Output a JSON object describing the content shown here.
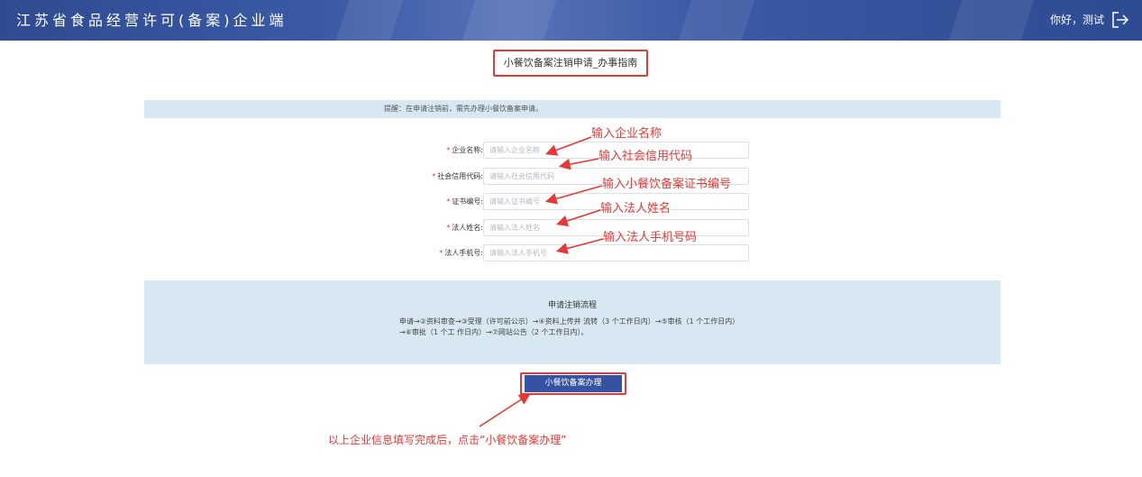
{
  "header": {
    "title": "江苏省食品经营许可(备案)企业端",
    "greeting": "你好，测试",
    "logout_icon": "logout-icon"
  },
  "guide": {
    "title": "小餐饮备案注销申请_办事指南"
  },
  "notice": {
    "text": "提醒：在申请注销前，需先办理小餐饮备案申请。"
  },
  "form": {
    "required_mark": "*",
    "fields": [
      {
        "label": "企业名称:",
        "placeholder": "请输入企业名称",
        "value": ""
      },
      {
        "label": "社会信用代码:",
        "placeholder": "请输入社会信用代码",
        "value": ""
      },
      {
        "label": "证书编号:",
        "placeholder": "请输入证书编号",
        "value": ""
      },
      {
        "label": "法人姓名:",
        "placeholder": "请输入法人姓名",
        "value": ""
      },
      {
        "label": "法人手机号:",
        "placeholder": "请输入法人手机号",
        "value": ""
      }
    ]
  },
  "annotations": [
    "输入企业名称",
    "输入社会信用代码",
    "输入小餐饮备案证书编号",
    "输入法人姓名",
    "输入法人手机号码"
  ],
  "process": {
    "title": "申请注销流程",
    "text": "申请→②资料审查→③受理（许可前公示）→④资料上传并 流转（3 个工作日内）→⑤审核（1 个工作日内）→⑥审批（1 个工 作日内）→⑦网站公告（2 个工作日内）。"
  },
  "button": {
    "label": "小餐饮备案办理"
  },
  "bottom_note": "以上企业信息填写完成后，点击“小餐饮备案办理”",
  "colors": {
    "header": "#3552a3",
    "accent": "#e53935",
    "panel": "#d7e8f2",
    "button": "#3552a3"
  }
}
